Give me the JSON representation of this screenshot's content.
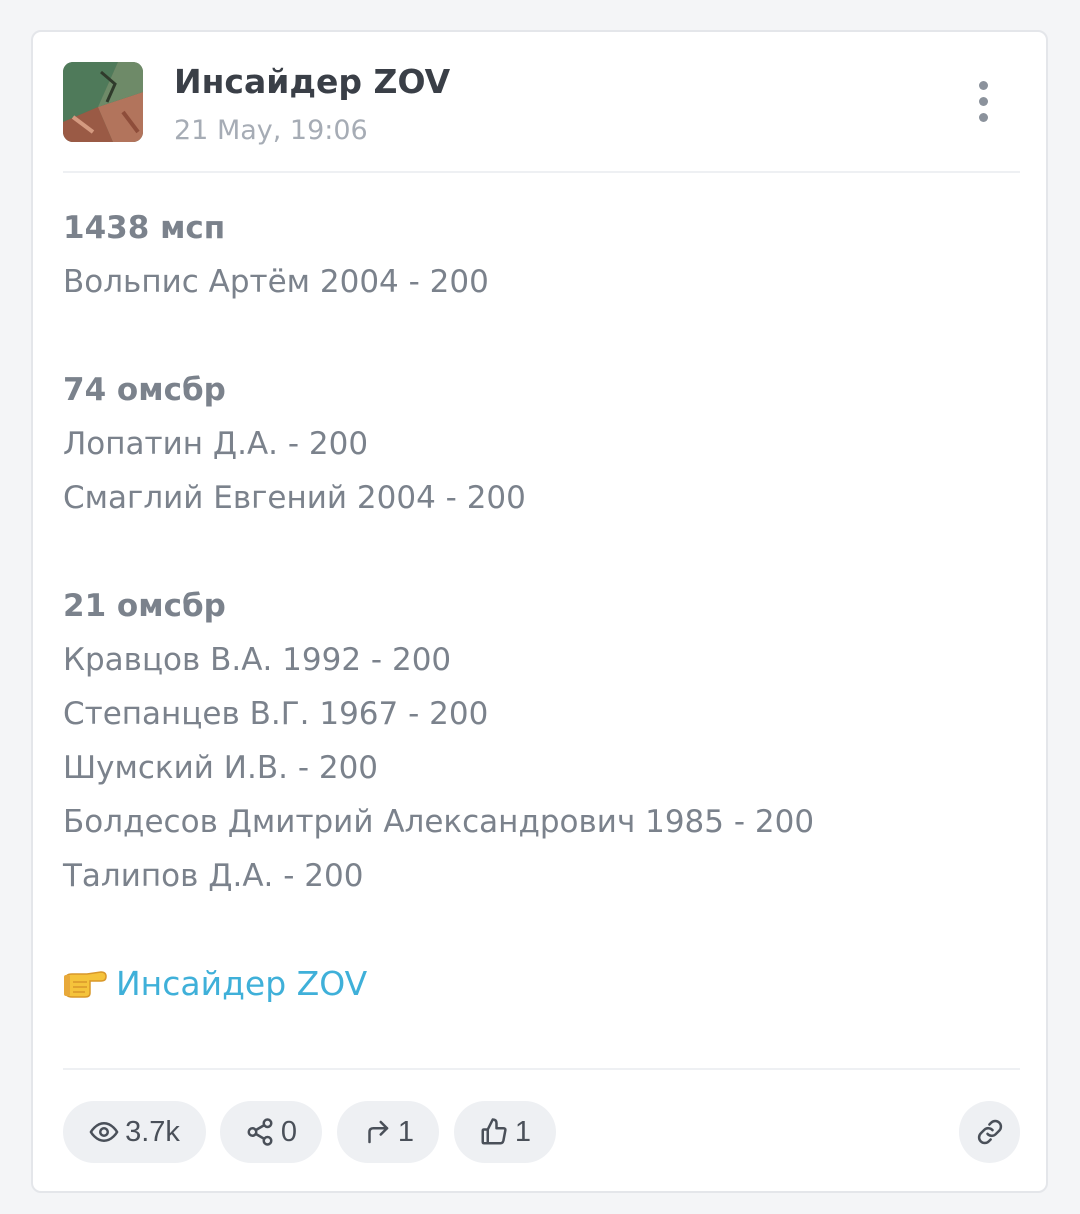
{
  "post": {
    "channel_name": "Инсайдер ZOV",
    "date": "21 May, 19:06"
  },
  "body": {
    "sections": [
      {
        "heading": "1438 мсп",
        "lines": [
          "Вольпис Артём 2004 - 200"
        ]
      },
      {
        "heading": "74 омсбр",
        "lines": [
          "Лопатин Д.А. - 200",
          "Смаглий Евгений 2004 - 200"
        ]
      },
      {
        "heading": "21 омсбр",
        "lines": [
          "Кравцов В.А. 1992 - 200",
          "Степанцев В.Г. 1967 - 200",
          "Шумский И.В. - 200",
          "Болдесов Дмитрий Александрович 1985 - 200",
          "Талипов Д.А. - 200"
        ]
      }
    ],
    "footer_link": "Инсайдер ZOV"
  },
  "stats": {
    "views": "3.7k",
    "shares": "0",
    "forwards": "1",
    "likes": "1"
  },
  "icons": {
    "avatar": "avatar-image",
    "menu": "more-vertical-icon",
    "pointer": "pointing-hand-emoji",
    "views": "eye-icon",
    "shares": "share-nodes-icon",
    "forwards": "forward-arrow-icon",
    "likes": "thumbs-up-icon",
    "copy_link": "link-icon"
  },
  "colors": {
    "link": "#3fb0d9",
    "text": "#7b828c",
    "title": "#3a3f47",
    "pill_bg": "#eef0f3"
  }
}
